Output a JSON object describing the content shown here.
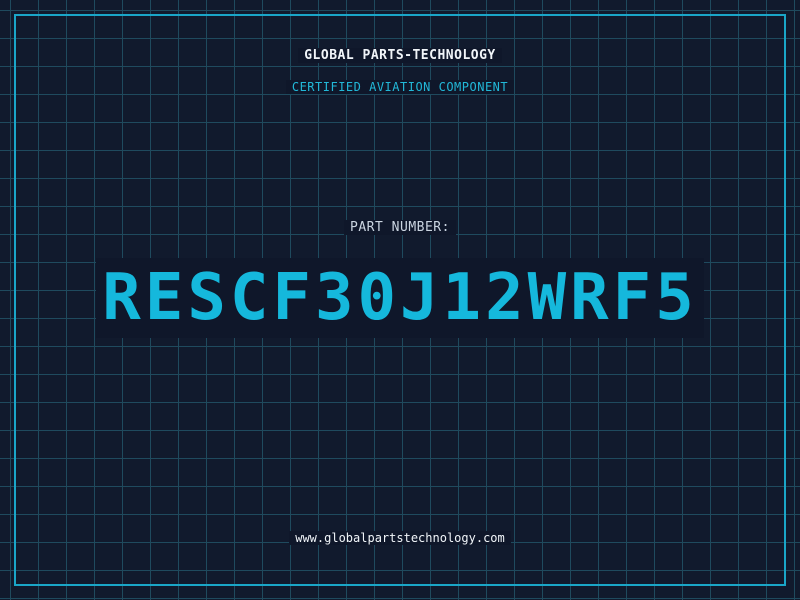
{
  "header": {
    "company_name": "GLOBAL PARTS-TECHNOLOGY",
    "subtitle": "CERTIFIED AVIATION COMPONENT"
  },
  "main": {
    "part_label": "PART NUMBER:",
    "part_number": "RESCF30J12WRF5"
  },
  "footer": {
    "website": "www.globalpartstechnology.com"
  },
  "colors": {
    "background": "#0f172a",
    "grid": "#1f4a5e",
    "accent": "#15b8dc",
    "text": "#f1f5f9"
  }
}
